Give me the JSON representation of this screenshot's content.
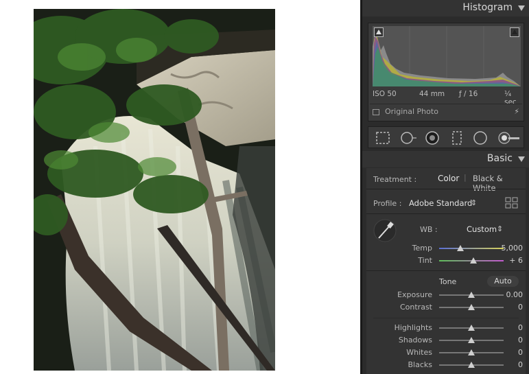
{
  "histogram": {
    "title": "Histogram",
    "iso": "ISO 50",
    "focal": "44 mm",
    "aperture": "ƒ / 16",
    "shutter": "¼ sec",
    "original_photo_label": "Original Photo"
  },
  "basic": {
    "title": "Basic",
    "treatment_label": "Treatment :",
    "treatment_color": "Color",
    "treatment_bw": "Black & White",
    "profile_label": "Profile :",
    "profile_value": "Adobe Standard",
    "profile_arrows": "⇕",
    "wb_label": "WB :",
    "wb_value": "Custom",
    "wb_arrows": "⇕",
    "tone_label": "Tone",
    "auto_label": "Auto",
    "sliders": {
      "temp": {
        "label": "Temp",
        "value": "5,000",
        "level": 0.33
      },
      "tint": {
        "label": "Tint",
        "value": "+ 6",
        "level": 0.53
      },
      "exposure": {
        "label": "Exposure",
        "value": "0.00",
        "level": 0.5
      },
      "contrast": {
        "label": "Contrast",
        "value": "0",
        "level": 0.5
      },
      "highlights": {
        "label": "Highlights",
        "value": "0",
        "level": 0.5
      },
      "shadows": {
        "label": "Shadows",
        "value": "0",
        "level": 0.5
      },
      "whites": {
        "label": "Whites",
        "value": "0",
        "level": 0.5
      },
      "blacks": {
        "label": "Blacks",
        "value": "0",
        "level": 0.5
      }
    }
  },
  "icons": {
    "histogram_collapse": "triangle-down-icon",
    "basic_collapse": "triangle-down-icon",
    "tools": [
      "crop-overlay-icon",
      "spot-removal-icon",
      "red-eye-icon",
      "graduated-filter-icon",
      "radial-filter-icon",
      "adjustment-brush-icon"
    ]
  },
  "colors": {
    "panel_bg": "#2b2b2b",
    "section_bg": "#333333",
    "temp_gradient_start": "#5a6fd6",
    "temp_gradient_end": "#d8d35a",
    "tint_gradient_start": "#5fbf5a",
    "tint_gradient_end": "#c45ad0"
  }
}
